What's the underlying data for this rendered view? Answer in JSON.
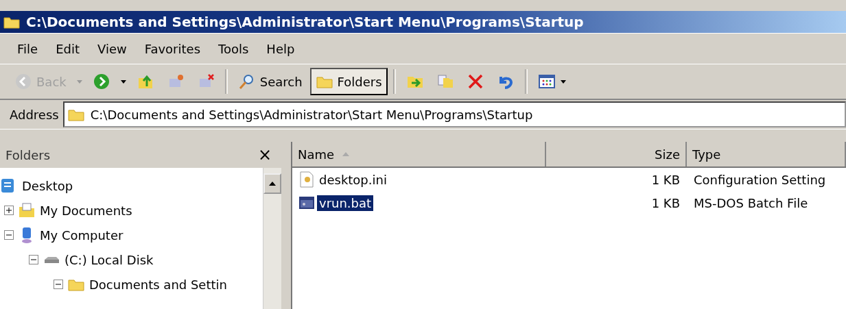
{
  "window": {
    "title": "C:\\Documents and Settings\\Administrator\\Start Menu\\Programs\\Startup"
  },
  "menu": [
    "File",
    "Edit",
    "View",
    "Favorites",
    "Tools",
    "Help"
  ],
  "toolbar": [
    {
      "kind": "back",
      "label": "Back",
      "disabled": true
    },
    {
      "kind": "dropdown",
      "disabled": true
    },
    {
      "kind": "forward",
      "disabled": false
    },
    {
      "kind": "dropdown",
      "disabled": false
    },
    {
      "kind": "up"
    },
    {
      "kind": "map"
    },
    {
      "kind": "unmap"
    },
    {
      "kind": "separator"
    },
    {
      "kind": "search",
      "label": "Search",
      "selected": false
    },
    {
      "kind": "folders",
      "label": "Folders",
      "selected": true
    },
    {
      "kind": "separator"
    },
    {
      "kind": "moveto"
    },
    {
      "kind": "copyto"
    },
    {
      "kind": "delete"
    },
    {
      "kind": "undo"
    },
    {
      "kind": "separator"
    },
    {
      "kind": "views"
    }
  ],
  "address": {
    "label": "Address",
    "value": "C:\\Documents and Settings\\Administrator\\Start Menu\\Programs\\Startup"
  },
  "folders_pane": {
    "title": "Folders",
    "close": "×",
    "tree": [
      {
        "label": "Desktop",
        "kind": "desktop",
        "children": [
          {
            "label": "My Documents",
            "kind": "documents",
            "expanded": false
          },
          {
            "label": "My Computer",
            "kind": "computer",
            "expanded": true,
            "children": [
              {
                "label": "(C:) Local Disk",
                "kind": "drive",
                "expanded": true,
                "children": [
                  {
                    "label": "Documents and Settin",
                    "kind": "folder",
                    "expanded": true
                  }
                ]
              }
            ]
          }
        ]
      }
    ]
  },
  "file_list": {
    "columns": [
      {
        "label": "Name",
        "sorted": true
      },
      {
        "label": "Size",
        "sorted": false
      },
      {
        "label": "Type",
        "sorted": false
      }
    ],
    "rows": [
      {
        "name": "desktop.ini",
        "kind": "settings",
        "size": "1 KB",
        "type": "Configuration Setting",
        "selected": false
      },
      {
        "name": "vrun.bat",
        "kind": "batch",
        "size": "1 KB",
        "type": "MS-DOS Batch File",
        "selected": true
      }
    ]
  }
}
